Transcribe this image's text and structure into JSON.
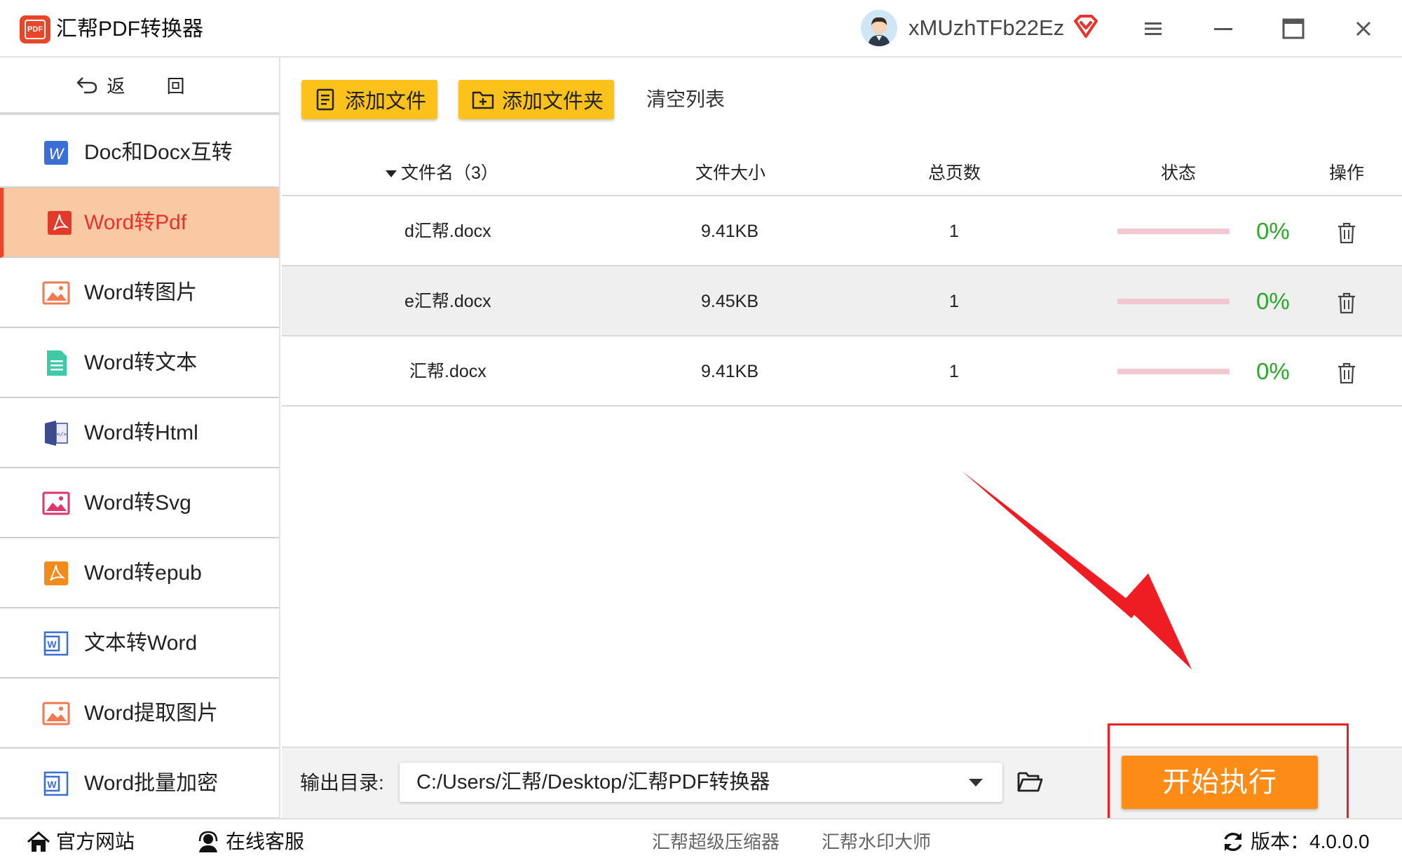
{
  "app": {
    "title": "汇帮PDF转换器",
    "logo_text": "PDF",
    "username": "xMUzhTFb22Ez"
  },
  "sidebar": {
    "back_label": "返 回",
    "items": [
      {
        "label": "Doc和Docx互转",
        "icon": "word-icon"
      },
      {
        "label": "Word转Pdf",
        "icon": "pdf-icon",
        "active": true
      },
      {
        "label": "Word转图片",
        "icon": "image-icon"
      },
      {
        "label": "Word转文本",
        "icon": "text-file-icon"
      },
      {
        "label": "Word转Html",
        "icon": "html-icon"
      },
      {
        "label": "Word转Svg",
        "icon": "svg-image-icon"
      },
      {
        "label": "Word转epub",
        "icon": "pdf-icon"
      },
      {
        "label": "文本转Word",
        "icon": "word-icon"
      },
      {
        "label": "Word提取图片",
        "icon": "image-icon"
      },
      {
        "label": "Word批量加密",
        "icon": "word-icon"
      }
    ]
  },
  "toolbar": {
    "add_file": "添加文件",
    "add_folder": "添加文件夹",
    "clear_list": "清空列表"
  },
  "table": {
    "headers": {
      "name": "文件名（3）",
      "size": "文件大小",
      "pages": "总页数",
      "status": "状态",
      "action": "操作"
    },
    "rows": [
      {
        "name": "d汇帮.docx",
        "size": "9.41KB",
        "pages": "1",
        "progress": 0,
        "percent": "0%"
      },
      {
        "name": "e汇帮.docx",
        "size": "9.45KB",
        "pages": "1",
        "progress": 0,
        "percent": "0%"
      },
      {
        "name": "汇帮.docx",
        "size": "9.41KB",
        "pages": "1",
        "progress": 0,
        "percent": "0%"
      }
    ]
  },
  "output": {
    "label": "输出目录:",
    "path": "C:/Users/汇帮/Desktop/汇帮PDF转换器"
  },
  "start_button": "开始执行",
  "footer": {
    "website": "官方网站",
    "support": "在线客服",
    "link1": "汇帮超级压缩器",
    "link2": "汇帮水印大师",
    "version": "版本：4.0.0.0"
  },
  "colors": {
    "accent_yellow": "#fcc21b",
    "start_orange": "#fd8c16",
    "active_item_bg": "#f8c9a3",
    "active_item_text": "#e8322b",
    "percent_green": "#29a829",
    "annotation_red": "#ee1d23"
  }
}
